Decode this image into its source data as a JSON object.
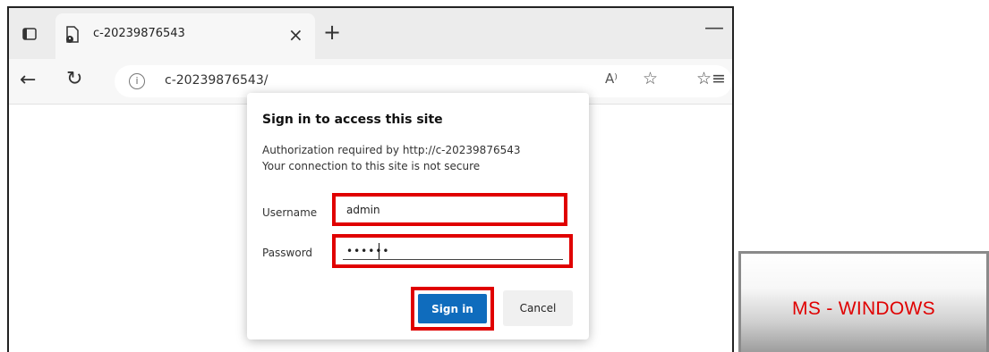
{
  "tab": {
    "title": "c-20239876543",
    "close_glyph": "×",
    "new_tab_glyph": "+",
    "minimize_glyph": "—"
  },
  "address": {
    "url": "c-20239876543/",
    "back_glyph": "←",
    "refresh_glyph": "↻",
    "info_glyph": "i",
    "read_aloud_glyph": "A⁾",
    "fav_add_glyph": "☆",
    "fav_list_glyph": "☆≡"
  },
  "dialog": {
    "title": "Sign in to access this site",
    "line1": "Authorization required by http://c-20239876543",
    "line2": "Your connection to this site is not secure",
    "username_label": "Username",
    "username_value": "admin",
    "password_label": "Password",
    "password_value": "••••••",
    "signin_label": "Sign in",
    "cancel_label": "Cancel"
  },
  "badge": {
    "label": "MS - WINDOWS"
  },
  "colors": {
    "highlight": "#e00000",
    "primary_button": "#0f6cbd"
  }
}
